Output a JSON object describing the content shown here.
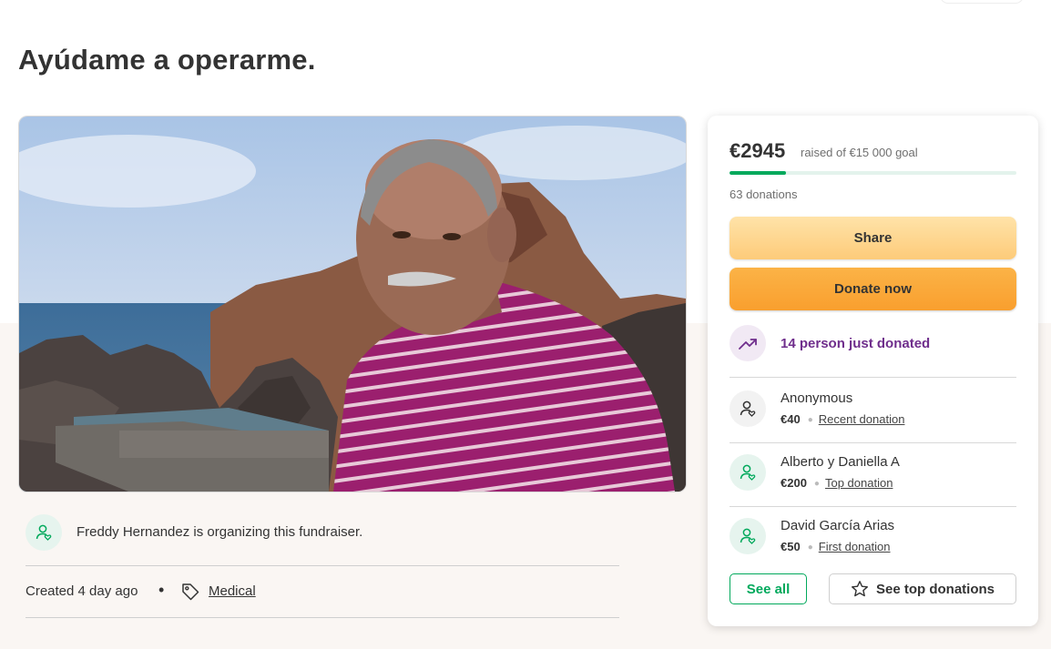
{
  "page": {
    "title": "Ayúdame a operarme."
  },
  "organizer": {
    "text": "Freddy Hernandez is organizing this fundraiser.",
    "created": "Created 4 day ago",
    "bullet": "•",
    "category": "Medical",
    "icons": {
      "organizer": "user-heart-icon",
      "category": "tag-icon"
    }
  },
  "donation_card": {
    "raised": "€2945",
    "goal_text": "raised of €15 000 goal",
    "progress_fraction": 0.196,
    "donations_count": "63 donations",
    "share_label": "Share",
    "donate_label": "Donate now",
    "trending_text": "14 person just donated",
    "donors": [
      {
        "name": "Anonymous",
        "amount": "€40",
        "tag": "Recent donation"
      },
      {
        "name": "Alberto y Daniella A",
        "amount": "€200",
        "tag": "Top donation"
      },
      {
        "name": "David García Arias",
        "amount": "€50",
        "tag": "First donation"
      }
    ],
    "see_all_label": "See all",
    "see_top_label": "See top donations",
    "icons": {
      "trend": "trending-up-icon",
      "donor": "user-heart-icon",
      "star": "star-icon"
    }
  },
  "colors": {
    "brand_green": "#02a95c",
    "donate_orange": "#f99f2e",
    "share_yellow": "#fdcb7a",
    "trend_purple": "#6f2e8c"
  }
}
